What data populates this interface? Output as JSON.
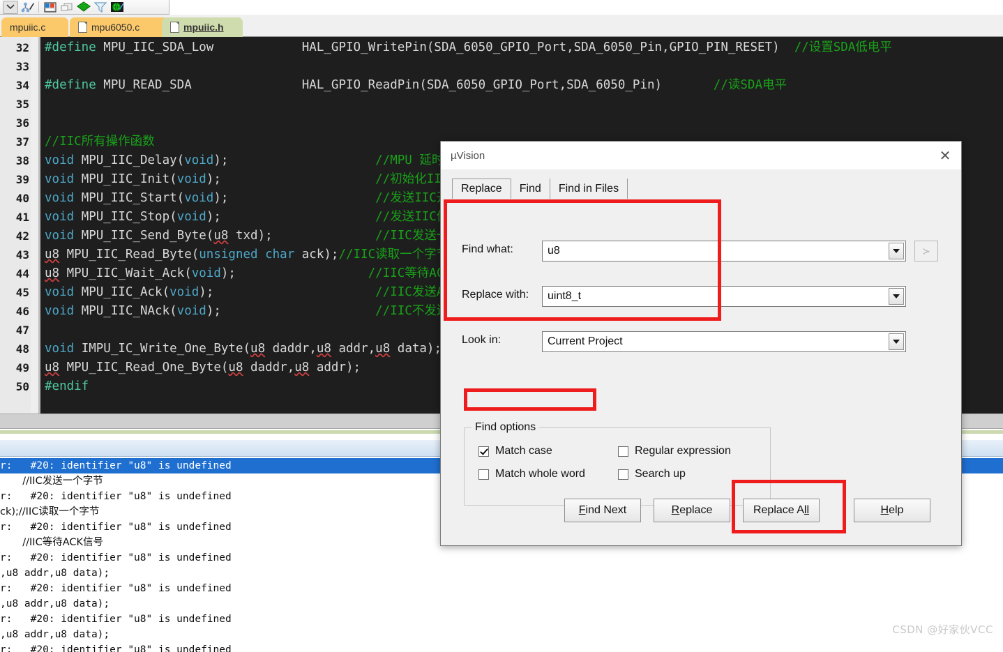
{
  "toolbar": {
    "buttons": [
      {
        "name": "dropdown-arrow-button",
        "glyph": "∨"
      },
      {
        "name": "manage-components-icon",
        "glyph": ""
      },
      {
        "name": "window-layout-icon",
        "glyph": ""
      },
      {
        "name": "book-icon",
        "glyph": ""
      },
      {
        "name": "diamond-green-icon",
        "glyph": ""
      },
      {
        "name": "filter-icon",
        "glyph": ""
      },
      {
        "name": "globe-icon",
        "glyph": ""
      }
    ]
  },
  "tabs": [
    {
      "label": "mpuiic.c",
      "active": false,
      "has_icon": false
    },
    {
      "label": "mpu6050.c",
      "active": false,
      "has_icon": true
    },
    {
      "label": "mpuiic.h",
      "active": true,
      "has_icon": true
    }
  ],
  "editor": {
    "lines": [
      {
        "no": "32",
        "segs": [
          {
            "t": "#define ",
            "c": "pp"
          },
          {
            "t": "MPU_IIC_SDA_Low",
            "c": ""
          },
          {
            "t": "            HAL_GPIO_WritePin(SDA_6050_GPIO_Port,SDA_6050_Pin,GPIO_PIN_RESET)  ",
            "c": ""
          },
          {
            "t": "//设置SDA低电平",
            "c": "cm"
          }
        ]
      },
      {
        "no": "33",
        "segs": []
      },
      {
        "no": "34",
        "segs": [
          {
            "t": "#define ",
            "c": "pp"
          },
          {
            "t": "MPU_READ_SDA",
            "c": ""
          },
          {
            "t": "               HAL_GPIO_ReadPin(SDA_6050_GPIO_Port,SDA_6050_Pin)       ",
            "c": ""
          },
          {
            "t": "//读SDA电平",
            "c": "cm"
          }
        ]
      },
      {
        "no": "35",
        "segs": []
      },
      {
        "no": "36",
        "segs": []
      },
      {
        "no": "37",
        "segs": [
          {
            "t": "//IIC所有操作函数",
            "c": "cm"
          }
        ]
      },
      {
        "no": "38",
        "segs": [
          {
            "t": "void",
            "c": "kw"
          },
          {
            "t": " MPU_IIC_Delay(",
            "c": ""
          },
          {
            "t": "void",
            "c": "kw"
          },
          {
            "t": ");                    ",
            "c": ""
          },
          {
            "t": "//MPU 延时函数",
            "c": "cm"
          }
        ]
      },
      {
        "no": "39",
        "segs": [
          {
            "t": "void",
            "c": "kw"
          },
          {
            "t": " MPU_IIC_Init(",
            "c": ""
          },
          {
            "t": "void",
            "c": "kw"
          },
          {
            "t": ");                     ",
            "c": ""
          },
          {
            "t": "//初始化IIC的IO口",
            "c": "cm"
          }
        ]
      },
      {
        "no": "40",
        "segs": [
          {
            "t": "void",
            "c": "kw"
          },
          {
            "t": " MPU_IIC_Start(",
            "c": ""
          },
          {
            "t": "void",
            "c": "kw"
          },
          {
            "t": ");                    ",
            "c": ""
          },
          {
            "t": "//发送IIC开始信号",
            "c": "cm"
          }
        ]
      },
      {
        "no": "41",
        "segs": [
          {
            "t": "void",
            "c": "kw"
          },
          {
            "t": " MPU_IIC_Stop(",
            "c": ""
          },
          {
            "t": "void",
            "c": "kw"
          },
          {
            "t": ");                     ",
            "c": ""
          },
          {
            "t": "//发送IIC停止信号",
            "c": "cm"
          }
        ]
      },
      {
        "no": "42",
        "segs": [
          {
            "t": "void",
            "c": "kw"
          },
          {
            "t": " MPU_IIC_Send_Byte(",
            "c": ""
          },
          {
            "t": "u8",
            "c": "sq"
          },
          {
            "t": " txd);              ",
            "c": ""
          },
          {
            "t": "//IIC发送一个字节",
            "c": "cm"
          }
        ]
      },
      {
        "no": "43",
        "segs": [
          {
            "t": "u8",
            "c": "sq"
          },
          {
            "t": " MPU_IIC_Read_Byte(",
            "c": ""
          },
          {
            "t": "unsigned char",
            "c": "kw"
          },
          {
            "t": " ack);",
            "c": ""
          },
          {
            "t": "//IIC读取一个字节",
            "c": "cm"
          }
        ]
      },
      {
        "no": "44",
        "segs": [
          {
            "t": "u8",
            "c": "sq"
          },
          {
            "t": " MPU_IIC_Wait_Ack(",
            "c": ""
          },
          {
            "t": "void",
            "c": "kw"
          },
          {
            "t": ");                  ",
            "c": ""
          },
          {
            "t": "//IIC等待ACK信号",
            "c": "cm"
          }
        ]
      },
      {
        "no": "45",
        "segs": [
          {
            "t": "void",
            "c": "kw"
          },
          {
            "t": " MPU_IIC_Ack(",
            "c": ""
          },
          {
            "t": "void",
            "c": "kw"
          },
          {
            "t": ");                      ",
            "c": ""
          },
          {
            "t": "//IIC发送ACK信号",
            "c": "cm"
          }
        ]
      },
      {
        "no": "46",
        "segs": [
          {
            "t": "void",
            "c": "kw"
          },
          {
            "t": " MPU_IIC_NAck(",
            "c": ""
          },
          {
            "t": "void",
            "c": "kw"
          },
          {
            "t": ");                     ",
            "c": ""
          },
          {
            "t": "//IIC不发送ACK信号",
            "c": "cm"
          }
        ]
      },
      {
        "no": "47",
        "segs": []
      },
      {
        "no": "48",
        "segs": [
          {
            "t": "void",
            "c": "kw"
          },
          {
            "t": " IMPU_IC_Write_One_Byte(",
            "c": ""
          },
          {
            "t": "u8",
            "c": "sq"
          },
          {
            "t": " daddr,",
            "c": ""
          },
          {
            "t": "u8",
            "c": "sq"
          },
          {
            "t": " addr,",
            "c": ""
          },
          {
            "t": "u8",
            "c": "sq"
          },
          {
            "t": " data);",
            "c": ""
          }
        ]
      },
      {
        "no": "49",
        "segs": [
          {
            "t": "u8",
            "c": "sq"
          },
          {
            "t": " MPU_IIC_Read_One_Byte(",
            "c": ""
          },
          {
            "t": "u8",
            "c": "sq"
          },
          {
            "t": " daddr,",
            "c": ""
          },
          {
            "t": "u8",
            "c": "sq"
          },
          {
            "t": " addr);",
            "c": ""
          }
        ]
      },
      {
        "no": "50",
        "segs": [
          {
            "t": "#endif",
            "c": "pp"
          }
        ]
      }
    ]
  },
  "output": {
    "lines": [
      {
        "text": "r:   #20: identifier \"u8\" is undefined",
        "selected": true,
        "cjk": false
      },
      {
        "text": "       //IIC发送一个字节",
        "selected": false,
        "cjk": true
      },
      {
        "text": "r:   #20: identifier \"u8\" is undefined",
        "selected": false,
        "cjk": false
      },
      {
        "text": "ck);//IIC读取一个字节",
        "selected": false,
        "cjk": true
      },
      {
        "text": "r:   #20: identifier \"u8\" is undefined",
        "selected": false,
        "cjk": false
      },
      {
        "text": "       //IIC等待ACK信号",
        "selected": false,
        "cjk": true
      },
      {
        "text": "r:   #20: identifier \"u8\" is undefined",
        "selected": false,
        "cjk": false
      },
      {
        "text": ",u8 addr,u8 data);",
        "selected": false,
        "cjk": false
      },
      {
        "text": "r:   #20: identifier \"u8\" is undefined",
        "selected": false,
        "cjk": false
      },
      {
        "text": ",u8 addr,u8 data);",
        "selected": false,
        "cjk": false
      },
      {
        "text": "r:   #20: identifier \"u8\" is undefined",
        "selected": false,
        "cjk": false
      },
      {
        "text": ",u8 addr,u8 data);",
        "selected": false,
        "cjk": false
      },
      {
        "text": "r:   #20: identifier \"u8\" is undefined",
        "selected": false,
        "cjk": false
      }
    ]
  },
  "watermark": "CSDN @好家伙VCC",
  "dialog": {
    "title": "µVision",
    "close_glyph": "✕",
    "tabs": [
      {
        "label": "Replace",
        "active": true
      },
      {
        "label": "Find",
        "active": false
      },
      {
        "label": "Find in Files",
        "active": false
      }
    ],
    "fields": {
      "find_what_label": "Find what:",
      "find_what_value": "u8",
      "replace_with_label": "Replace with:",
      "replace_with_value": "uint8_t",
      "look_in_label": "Look in:",
      "look_in_value": "Current Project",
      "expand_button_glyph": "≻"
    },
    "find_options": {
      "legend": "Find options",
      "items": [
        {
          "label": "Match case",
          "checked": true
        },
        {
          "label": "Regular expression",
          "checked": false
        },
        {
          "label": "Match whole word",
          "checked": false
        },
        {
          "label": "Search up",
          "checked": false
        }
      ]
    },
    "buttons": [
      {
        "pre": "F",
        "rest": "ind Next"
      },
      {
        "pre": "R",
        "rest": "eplace"
      },
      {
        "pre": "Replace A",
        "rest": "ll",
        "underline_last": true
      },
      {
        "pre": "H",
        "rest": "elp"
      }
    ]
  },
  "colors": {
    "highlight_red": "#ee1c1c",
    "selection_blue": "#1f6fd0",
    "editor_bg": "#1e1e1e",
    "tab_active": "#cfdcae",
    "tab_inactive": "#fbc96a"
  }
}
